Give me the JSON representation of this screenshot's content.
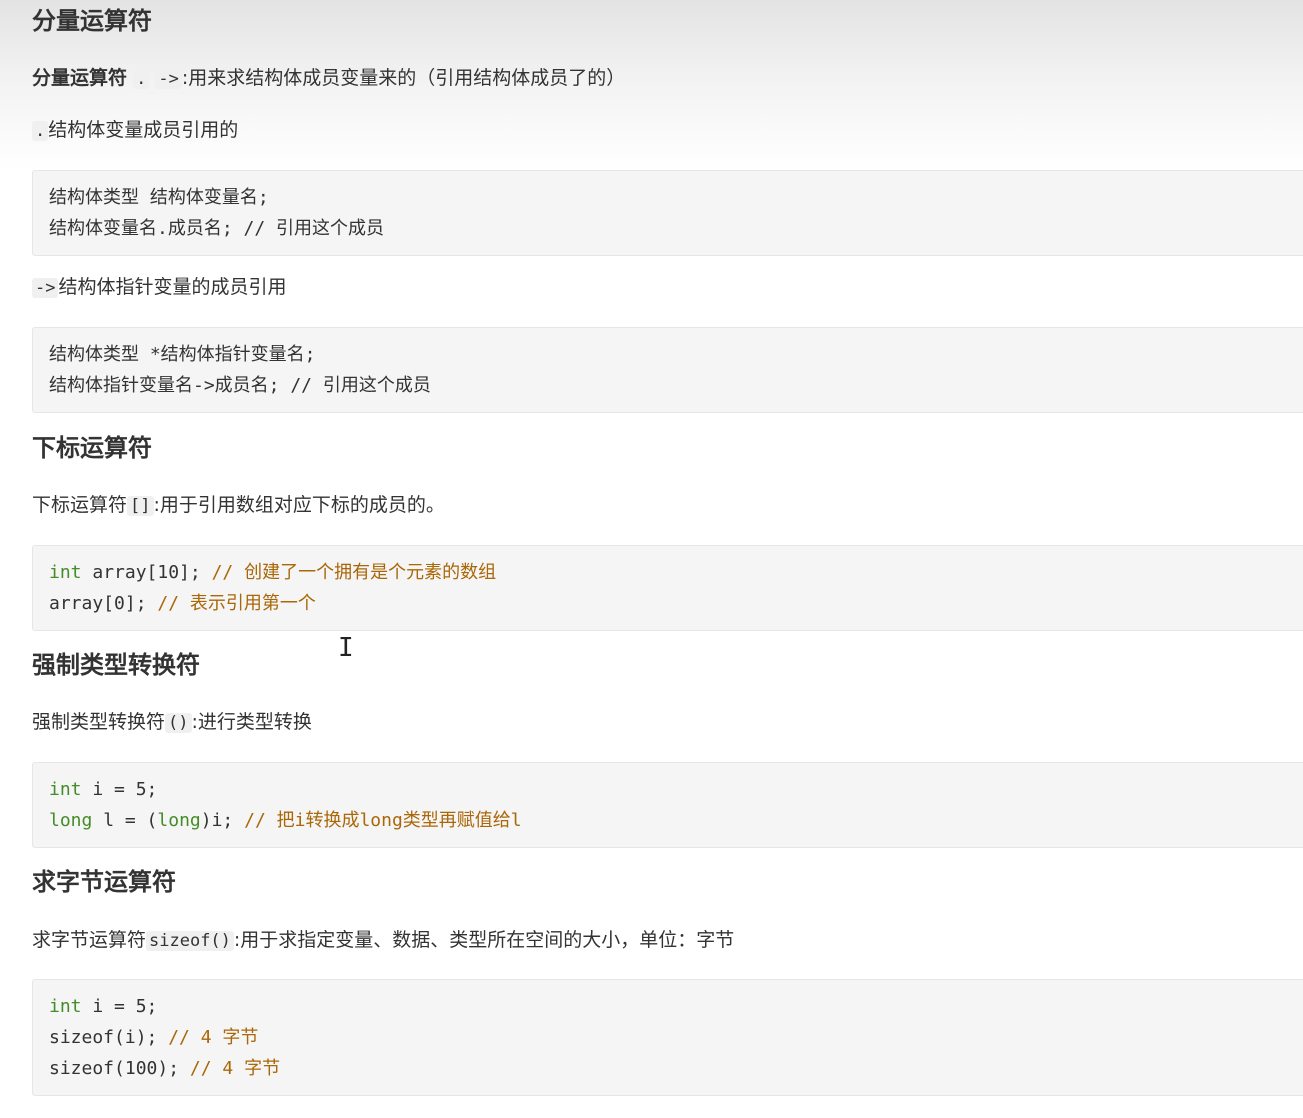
{
  "sections": {
    "s1": {
      "heading": "分量运算符",
      "intro_label": "分量运算符",
      "intro_dot": ".",
      "intro_arrow": "->",
      "intro_rest": ":用来求结构体成员变量来的（引用结构体成员了的）",
      "dot_code": ".",
      "dot_text": "结构体变量成员引用的",
      "code1": [
        "结构体类型 结构体变量名;",
        "结构体变量名.成员名; // 引用这个成员"
      ],
      "arrow_code": "->",
      "arrow_text": "结构体指针变量的成员引用",
      "code2": [
        "结构体类型 *结构体指针变量名;",
        "结构体指针变量名->成员名; // 引用这个成员"
      ]
    },
    "s2": {
      "heading": "下标运算符",
      "para_before": "下标运算符",
      "para_code": "[]",
      "para_after": ":用于引用数组对应下标的成员的。",
      "code": {
        "l1_kw": "int",
        "l1_plain": " array[10]; ",
        "l1_comment": "// 创建了一个拥有是个元素的数组",
        "l2_plain": "array[0]; ",
        "l2_comment": "// 表示引用第一个"
      }
    },
    "s3": {
      "heading": "强制类型转换符",
      "para_before": "强制类型转换符",
      "para_code": "()",
      "para_after": ":进行类型转换",
      "code": {
        "l1_kw": "int",
        "l1_plain": " i = 5;",
        "l2_kw1": "long",
        "l2_plain1": " l = (",
        "l2_kw2": "long",
        "l2_plain2": ")i; ",
        "l2_comment": "// 把i转换成long类型再赋值给l"
      }
    },
    "s4": {
      "heading": "求字节运算符",
      "para_before": "求字节运算符",
      "para_code": "sizeof()",
      "para_after": ":用于求指定变量、数据、类型所在空间的大小，单位：字节",
      "code": {
        "l1_kw": "int",
        "l1_plain": " i = 5;",
        "l2_plain": "sizeof(i); ",
        "l2_comment": "// 4 字节",
        "l3_plain": "sizeof(100); ",
        "l3_comment": "// 4 字节"
      }
    }
  },
  "cursor_glyph": "I",
  "colors": {
    "keyword": "#448c27",
    "comment": "#aa6708",
    "code_bg": "#f5f5f5"
  }
}
